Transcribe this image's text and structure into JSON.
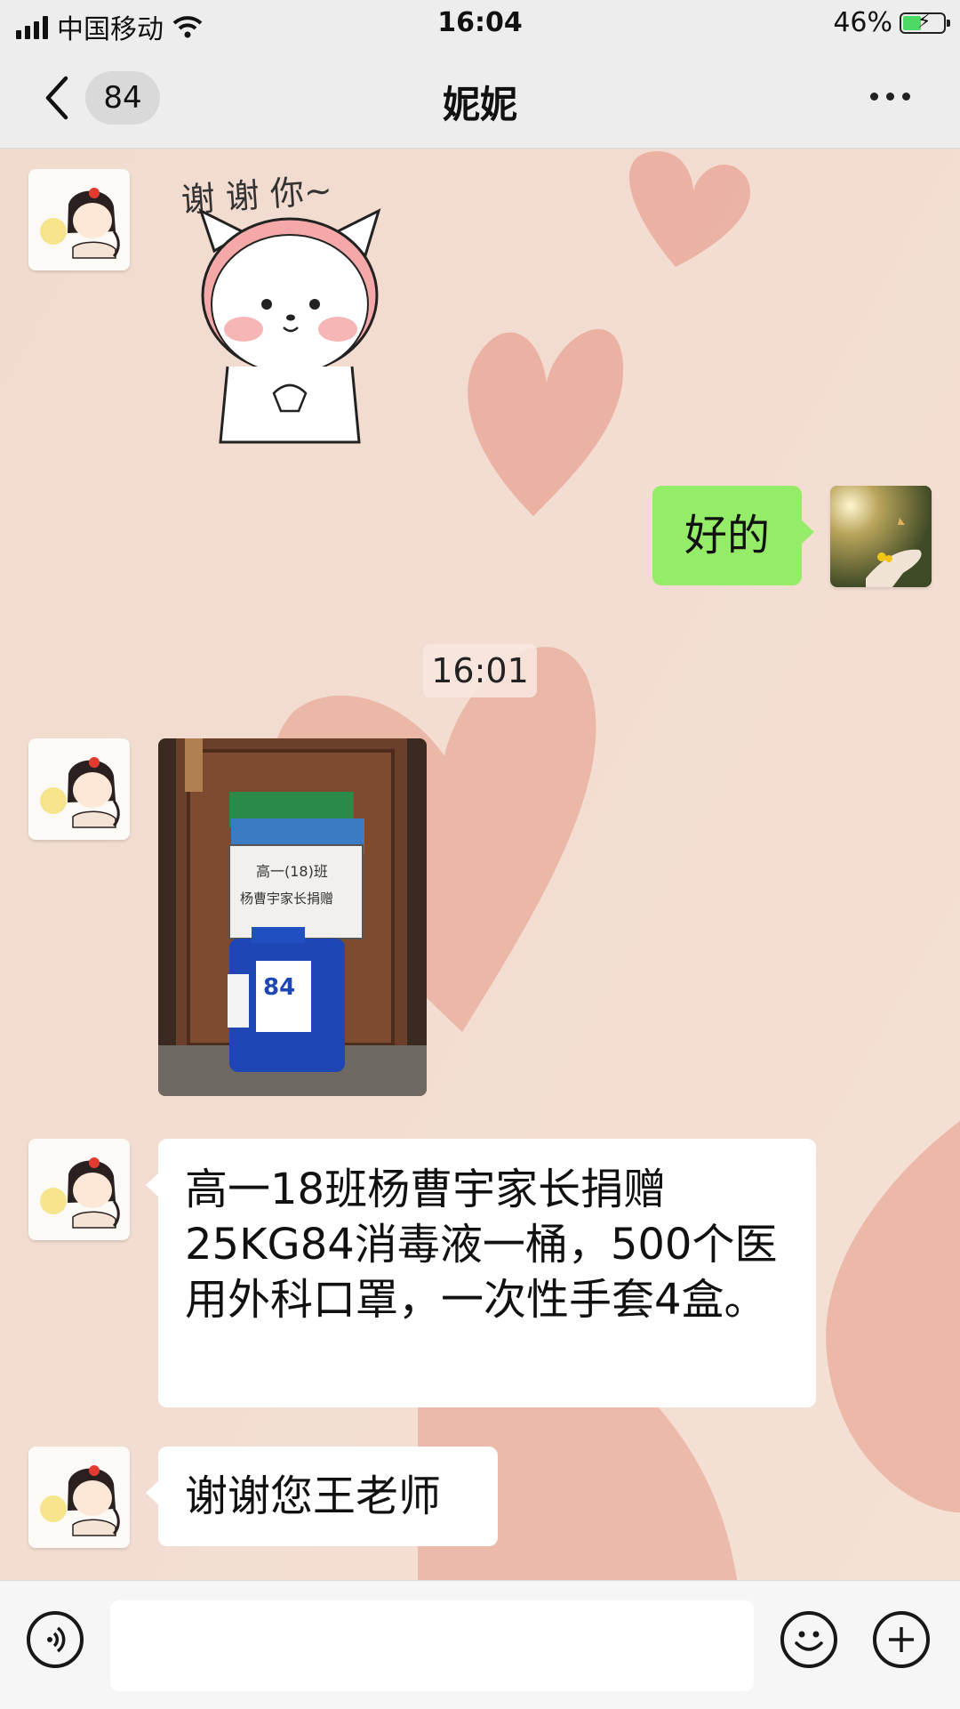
{
  "status_bar": {
    "carrier": "中国移动",
    "time": "16:04",
    "battery_percent": "46%",
    "battery_level": 0.46
  },
  "nav": {
    "unread_count": "84",
    "title": "妮妮"
  },
  "messages": [
    {
      "from": "contact",
      "type": "sticker",
      "sticker_text": "谢 谢 你~"
    },
    {
      "from": "me",
      "type": "text",
      "text": "好的"
    },
    {
      "type": "time",
      "text": "16:01"
    },
    {
      "from": "contact",
      "type": "image",
      "note_line1": "高一(18)班",
      "note_line2": "杨曹宇家长捐赠",
      "bottle_label": "84"
    },
    {
      "from": "contact",
      "type": "text",
      "text": "高一18班杨曹宇家长捐赠25KG84消毒液一桶，500个医用外科口罩，一次性手套4盒。"
    },
    {
      "from": "contact",
      "type": "text",
      "text": "谢谢您王老师"
    }
  ],
  "input_bar": {
    "placeholder": ""
  },
  "icons": {
    "voice": "voice-icon",
    "emoji": "emoji-icon",
    "plus": "plus-icon",
    "back": "chevron-left-icon",
    "more": "more-dots-icon"
  },
  "colors": {
    "incoming_bubble": "#ffffff",
    "outgoing_bubble": "#95ec69",
    "chat_background": "#f3ddd2",
    "heart": "#e59a88"
  }
}
